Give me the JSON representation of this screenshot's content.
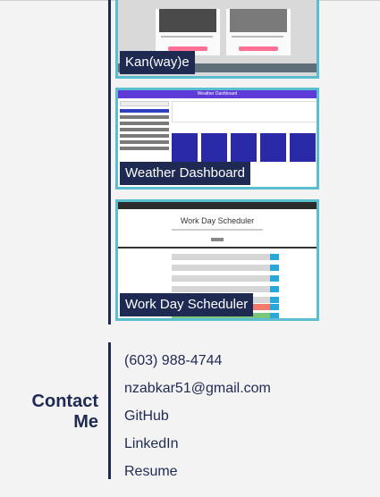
{
  "projects": [
    {
      "label": "Kan(way)e"
    },
    {
      "label": "Weather Dashboard"
    },
    {
      "label": "Work Day Scheduler"
    }
  ],
  "weather_preview": {
    "header": "Weather Dashboard"
  },
  "scheduler_preview": {
    "title": "Work Day Scheduler"
  },
  "contact": {
    "title_line1": "Contact",
    "title_line2": "Me",
    "items": [
      "(603) 988-4744",
      "nzabkar51@gmail.com",
      "GitHub",
      "LinkedIn",
      "Resume"
    ]
  },
  "colors": {
    "accent": "#59bfd0",
    "navy": "#1f2a53",
    "background": "#f3f3f3"
  }
}
